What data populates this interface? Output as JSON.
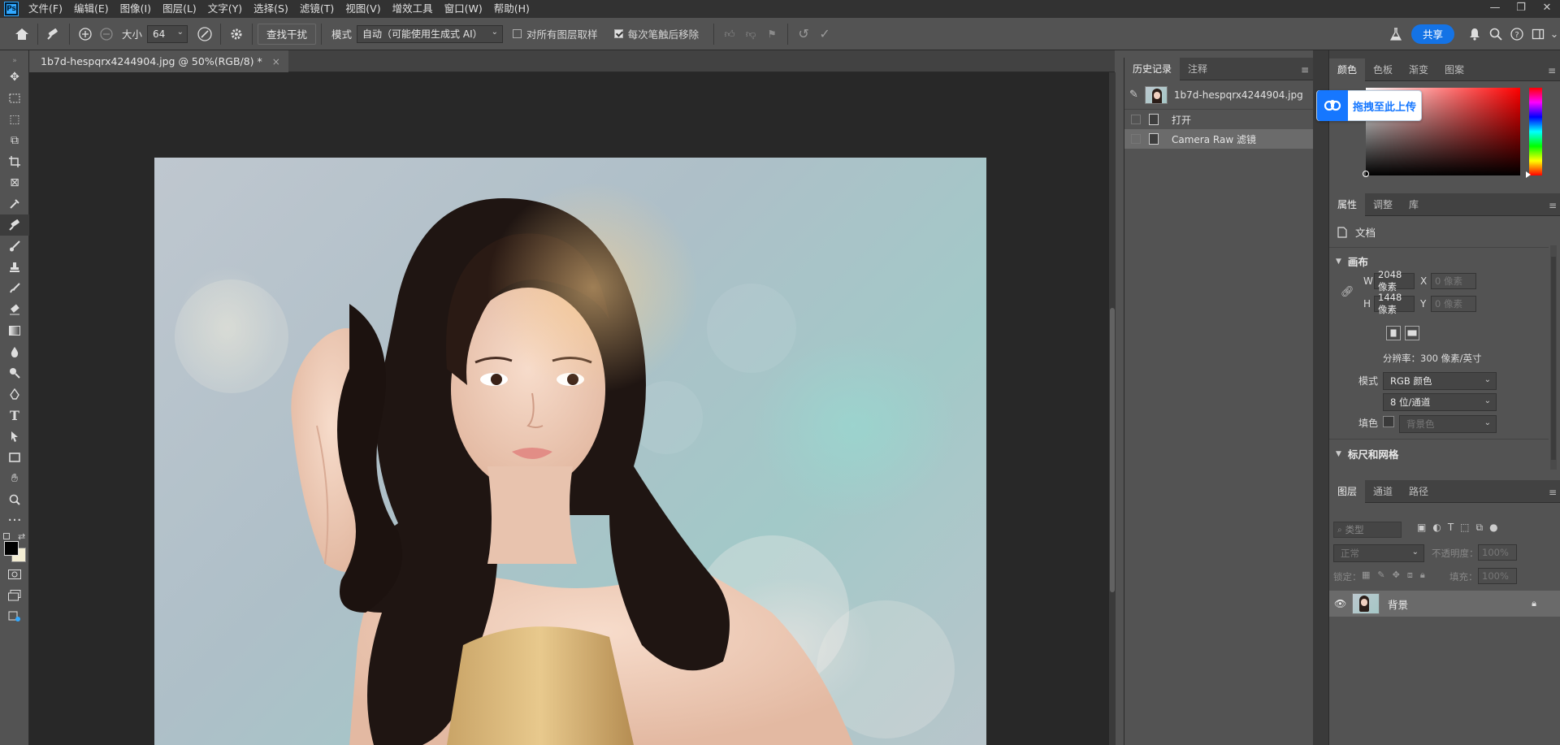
{
  "app": {
    "logo": "Ps"
  },
  "menu": [
    "文件(F)",
    "编辑(E)",
    "图像(I)",
    "图层(L)",
    "文字(Y)",
    "选择(S)",
    "滤镜(T)",
    "视图(V)",
    "增效工具",
    "窗口(W)",
    "帮助(H)"
  ],
  "window_controls": {
    "minimize": "—",
    "restore": "❐",
    "close": "✕"
  },
  "options": {
    "size_label": "大小",
    "size_value": "64",
    "find_distractions": "查找干扰",
    "mode_label": "模式",
    "mode_value": "自动（可能使用生成式 AI）",
    "sample_all": "对所有图层取样",
    "remove_after_stroke": "每次笔触后移除",
    "share": "共享"
  },
  "document": {
    "tab_title": "1b7d-hespqrx4244904.jpg @ 50%(RGB/8) *",
    "close": "×"
  },
  "history": {
    "tabs": [
      "历史记录",
      "注释"
    ],
    "snapshot": "1b7d-hespqrx4244904.jpg",
    "items": [
      "打开",
      "Camera Raw 滤镜"
    ]
  },
  "color_panel": {
    "tabs": [
      "颜色",
      "色板",
      "渐变",
      "图案"
    ],
    "foreground": "#000000",
    "background": "#f3edd3"
  },
  "baidu_upload": {
    "label": "拖拽至此上传"
  },
  "properties": {
    "tabs": [
      "属性",
      "调整",
      "库"
    ],
    "doc_label": "文档",
    "canvas_title": "画布",
    "w_label": "W",
    "w_value": "2048 像素",
    "h_label": "H",
    "h_value": "1448 像素",
    "x_label": "X",
    "x_value": "0 像素",
    "y_label": "Y",
    "y_value": "0 像素",
    "resolution": "分辨率：300 像素/英寸",
    "mode_label": "模式",
    "mode_value": "RGB 颜色",
    "depth_value": "8 位/通道",
    "fill_label": "填色",
    "fill_value": "背景色",
    "rulers_title": "标尺和网格"
  },
  "layers": {
    "tabs": [
      "图层",
      "通道",
      "路径"
    ],
    "filter_placeholder": "类型",
    "blend_mode": "正常",
    "opacity_label": "不透明度：",
    "opacity_value": "100%",
    "lock_label": "锁定：",
    "fill_label": "填充：",
    "fill_value": "100%",
    "layer_name": "背景"
  }
}
